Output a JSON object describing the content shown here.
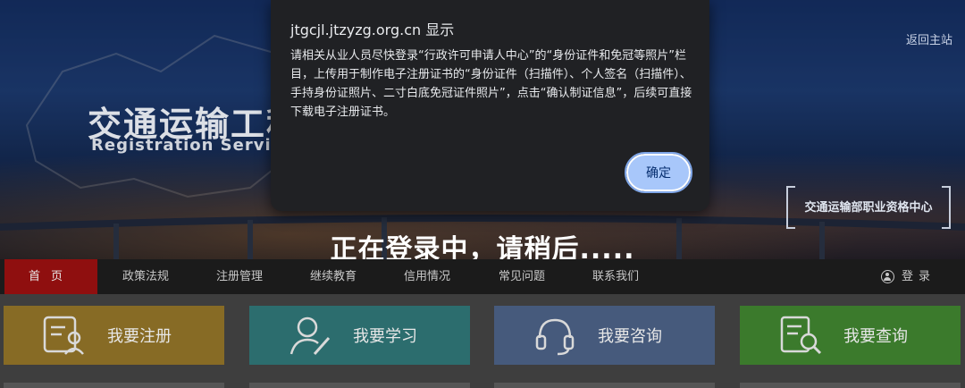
{
  "banner": {
    "title": "交通运输工程",
    "subtitle": "Registration  Service Syst",
    "return_link": "返回主站",
    "org_tag": "交通运输部职业资格中心",
    "loading_text": "正在登录中，请稍后....."
  },
  "nav": {
    "items": [
      "首页",
      "政策法规",
      "注册管理",
      "继续教育",
      "信用情况",
      "常见问题",
      "联系我们"
    ],
    "login": "登录"
  },
  "cards": [
    {
      "label": "我要注册",
      "icon": "registration-icon",
      "color": "#876b25"
    },
    {
      "label": "我要学习",
      "icon": "study-icon",
      "color": "#2c6d6e"
    },
    {
      "label": "我要咨询",
      "icon": "headset-icon",
      "color": "#465a7c"
    },
    {
      "label": "我要查询",
      "icon": "document-search-icon",
      "color": "#3b7a2c"
    }
  ],
  "dialog": {
    "title": "jtgcjl.jtzyzg.org.cn 显示",
    "message": "请相关从业人员尽快登录“行政许可申请人中心”的“身份证件和免冠等照片”栏目，上传用于制作电子注册证书的“身份证件（扫描件）、个人签名（扫描件）、手持身份证照片、二寸白底免冠证件照片”，点击“确认制证信息”，后续可直接下载电子注册证书。",
    "ok_label": "确定"
  },
  "colors": {
    "nav_active": "#8f0f0f",
    "dialog_bg": "#202124",
    "button_bg": "#a8c7fa"
  }
}
